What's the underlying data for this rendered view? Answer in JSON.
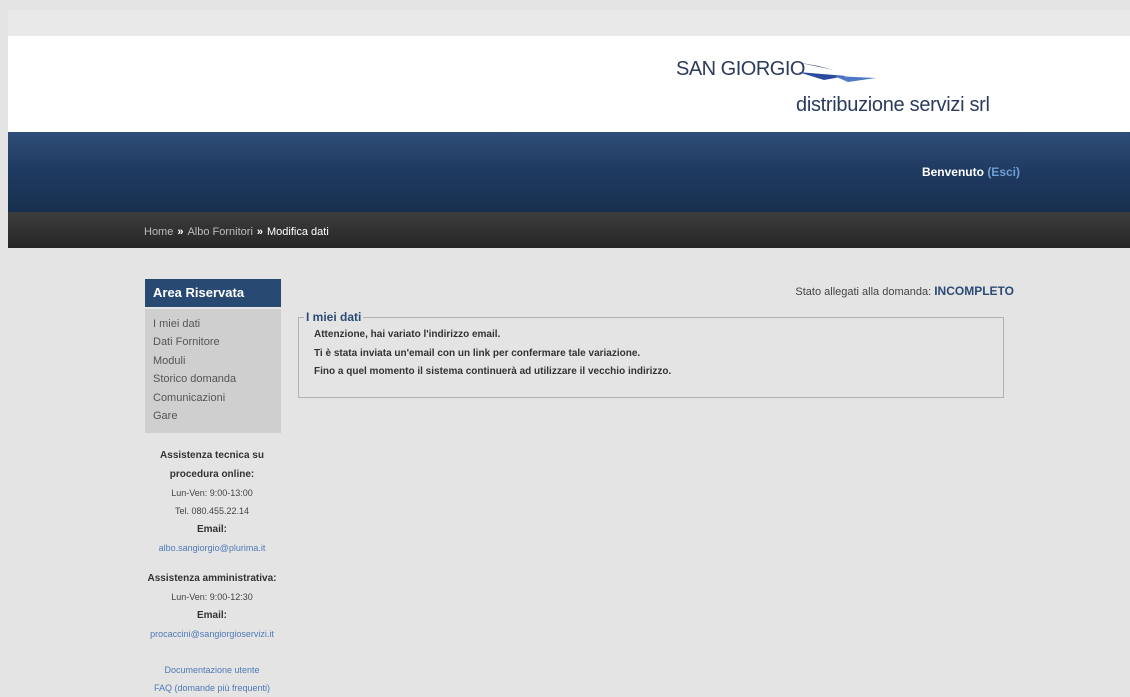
{
  "header": {
    "logo_name": "SAN GIORGIO",
    "logo_sub": "distribuzione servizi srl"
  },
  "topbar": {
    "welcome": "Benvenuto",
    "logout": "(Esci)"
  },
  "breadcrumb": {
    "home": "Home",
    "separator": "»",
    "albo": "Albo Fornitori",
    "current": "Modifica dati"
  },
  "sidebar": {
    "title": "Area Riservata",
    "items": [
      {
        "label": "I miei dati"
      },
      {
        "label": "Dati Fornitore"
      },
      {
        "label": "Moduli"
      },
      {
        "label": "Storico domanda"
      },
      {
        "label": "Comunicazioni"
      },
      {
        "label": "Gare"
      }
    ],
    "tech_support": {
      "title_1": "Assistenza tecnica su",
      "title_2": "procedura online:",
      "hours": "Lun-Ven: 9:00-13:00",
      "phone": "Tel. 080.455.22.14",
      "email_label": "Email:",
      "email": "albo.sangiorgio@plurima.it"
    },
    "admin_support": {
      "title": "Assistenza amministrativa:",
      "hours": "Lun-Ven: 9:00-12:30",
      "email_label": "Email:",
      "email": "procaccini@sangiorgioservizi.it"
    },
    "links": {
      "docs": "Documentazione utente",
      "faq": "FAQ (domande più frequenti)"
    }
  },
  "main": {
    "status_label": "Stato allegati alla domanda:",
    "status_value": "INCOMPLETO",
    "box_title": "I miei dati",
    "messages": [
      "Attenzione, hai variato l'indirizzo email.",
      "Ti è stata inviata un'email con un link per confermare tale variazione.",
      "Fino a quel momento il sistema continuerà ad utilizzare il vecchio indirizzo."
    ]
  },
  "colors": {
    "brand_blue": "#284a72",
    "link_blue": "#4f79b6",
    "header_bar": "#1f3a60"
  }
}
